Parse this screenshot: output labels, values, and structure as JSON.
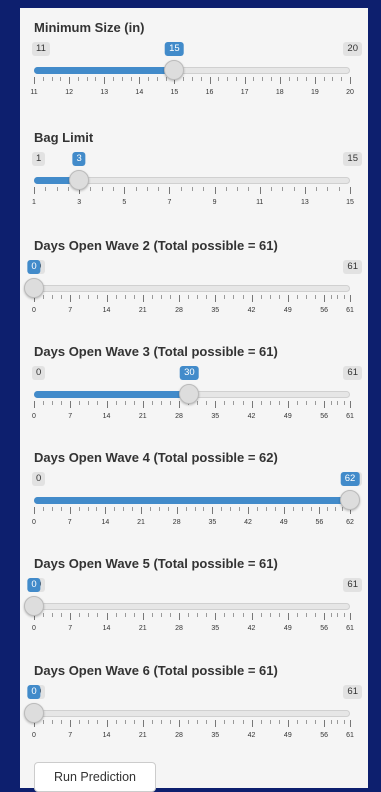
{
  "sliders": [
    {
      "id": "minimum-size",
      "label": "Minimum Size (in)",
      "min": 11,
      "max": 20,
      "value": 15,
      "min_label": "11",
      "max_label": "20",
      "value_label": "15",
      "tick_labels": [
        "11",
        "12",
        "13",
        "14",
        "15",
        "16",
        "17",
        "18",
        "19",
        "20"
      ]
    },
    {
      "id": "bag-limit",
      "label": "Bag Limit",
      "min": 1,
      "max": 15,
      "value": 3,
      "min_label": "1",
      "max_label": "15",
      "value_label": "3",
      "tick_labels": [
        "1",
        "3",
        "5",
        "7",
        "9",
        "11",
        "13",
        "15"
      ]
    },
    {
      "id": "days-open-wave-2",
      "label": "Days Open Wave 2 (Total possible = 61)",
      "min": 0,
      "max": 61,
      "value": 0,
      "min_label": "0",
      "max_label": "61",
      "value_label": "0",
      "tick_labels": [
        "0",
        "7",
        "14",
        "21",
        "28",
        "35",
        "42",
        "49",
        "56",
        "61"
      ]
    },
    {
      "id": "days-open-wave-3",
      "label": "Days Open Wave 3 (Total possible = 61)",
      "min": 0,
      "max": 61,
      "value": 30,
      "min_label": "0",
      "max_label": "61",
      "value_label": "30",
      "tick_labels": [
        "0",
        "7",
        "14",
        "21",
        "28",
        "35",
        "42",
        "49",
        "56",
        "61"
      ]
    },
    {
      "id": "days-open-wave-4",
      "label": "Days Open Wave 4 (Total possible = 62)",
      "min": 0,
      "max": 62,
      "value": 62,
      "min_label": "0",
      "max_label": "62",
      "value_label": "62",
      "tick_labels": [
        "0",
        "7",
        "14",
        "21",
        "28",
        "35",
        "42",
        "49",
        "56",
        "62"
      ]
    },
    {
      "id": "days-open-wave-5",
      "label": "Days Open Wave 5 (Total possible = 61)",
      "min": 0,
      "max": 61,
      "value": 0,
      "min_label": "0",
      "max_label": "61",
      "value_label": "0",
      "tick_labels": [
        "0",
        "7",
        "14",
        "21",
        "28",
        "35",
        "42",
        "49",
        "56",
        "61"
      ]
    },
    {
      "id": "days-open-wave-6",
      "label": "Days Open Wave 6 (Total possible = 61)",
      "min": 0,
      "max": 61,
      "value": 0,
      "min_label": "0",
      "max_label": "61",
      "value_label": "0",
      "tick_labels": [
        "0",
        "7",
        "14",
        "21",
        "28",
        "35",
        "42",
        "49",
        "56",
        "61"
      ]
    }
  ],
  "actions": {
    "run_label": "Run Prediction"
  },
  "colors": {
    "page_background": "#0d1f6e",
    "panel_background": "#f5f5f5",
    "slider_fill": "#428bca",
    "value_bubble": "#428bca",
    "minmax_badge": "#e2e2e2"
  }
}
